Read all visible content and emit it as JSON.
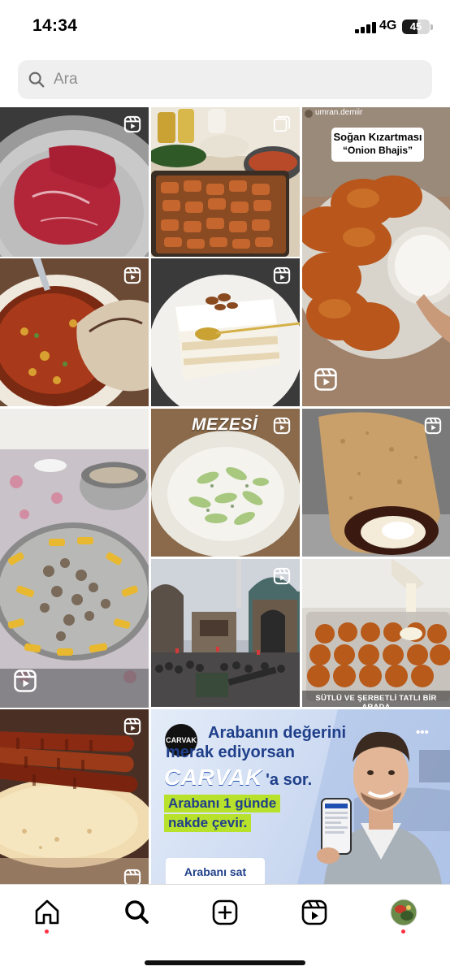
{
  "status": {
    "time": "14:34",
    "network": "4G",
    "battery": "45",
    "battery_level": 0.45
  },
  "search": {
    "placeholder": "Ara"
  },
  "grid": {
    "tile_3_username": "umran.demiir",
    "tile_3_title_line1": "Soğan Kızartması",
    "tile_3_title_line2": "“Onion Bhajis”",
    "tile_8_caption": "MEZESİ",
    "tile_12_caption": "SÜTLÜ VE ŞERBETLİ TATLI BİR ARADA"
  },
  "ad": {
    "brand": "CARVAK",
    "headline_line1": "Arabanın değerini",
    "headline_line2": "merak ediyorsan",
    "brand_big": "CARVAK",
    "tagline": "'a sor.",
    "offer_line1": "Arabanı 1 günde",
    "offer_line2": "nakde çevir.",
    "cta": "Arabanı sat",
    "more": "•••"
  },
  "nav": {
    "items": [
      "home",
      "search",
      "create",
      "reels",
      "profile"
    ]
  },
  "colors": {
    "notification_dot": "#ff3040",
    "ad_offer_bg": "#b7e12b",
    "ad_blue": "#1f4fb0"
  }
}
